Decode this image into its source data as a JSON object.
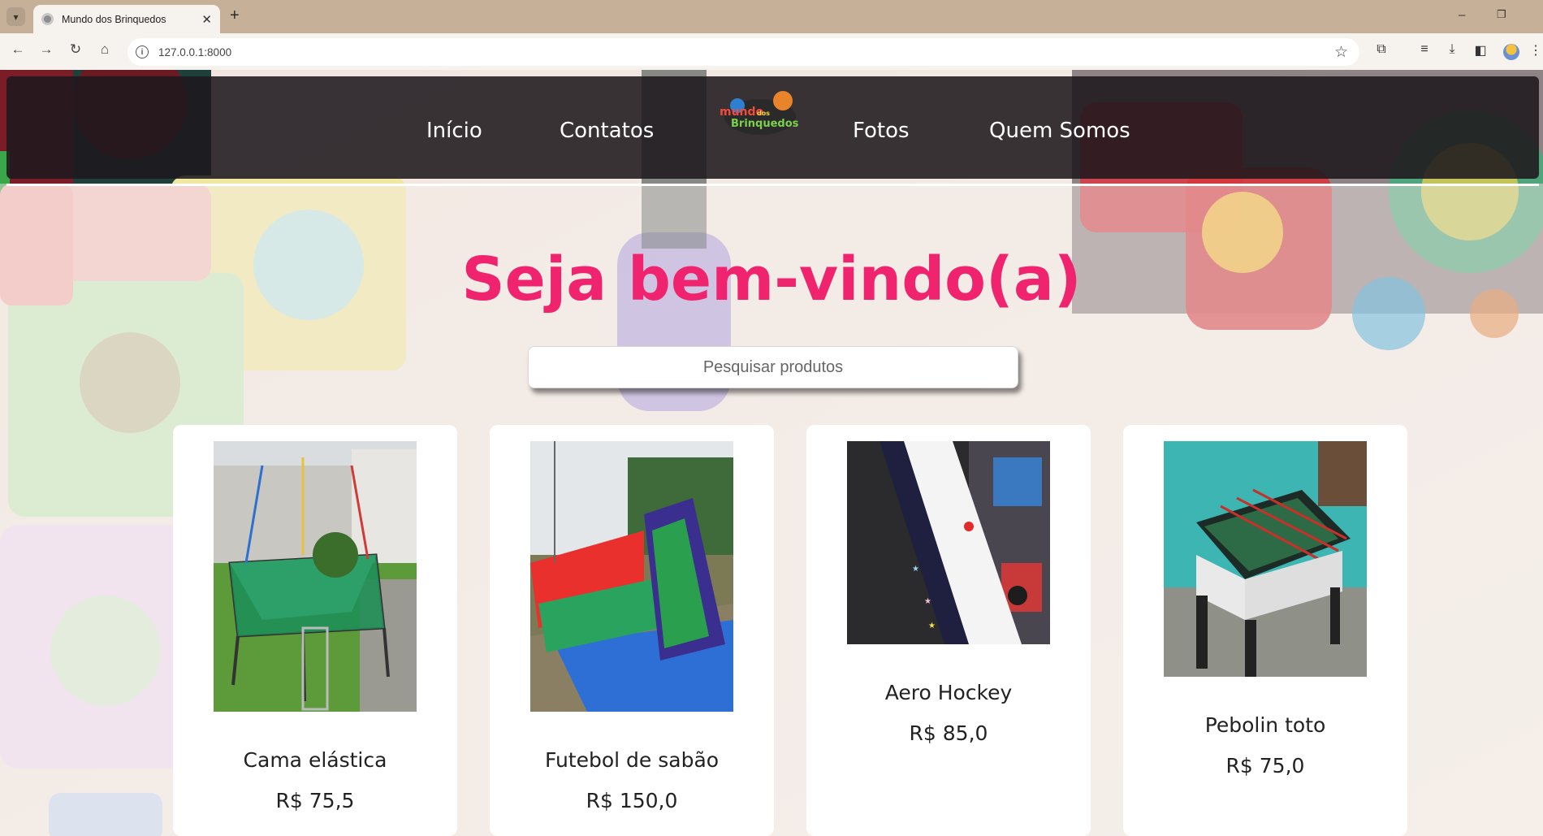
{
  "browser": {
    "tab_title": "Mundo dos Brinquedos",
    "url": "127.0.0.1:8000"
  },
  "nav": {
    "links": [
      "Início",
      "Contatos",
      "Fotos",
      "Quem Somos"
    ],
    "logo_text_top": "mundo",
    "logo_text_mid": "dos",
    "logo_text_bottom": "Brinquedos"
  },
  "hero": {
    "title": "Seja bem-vindo(a)"
  },
  "search": {
    "placeholder": "Pesquisar produtos"
  },
  "products": [
    {
      "name": "Cama elástica",
      "price": "R$ 75,5"
    },
    {
      "name": "Futebol de sabão",
      "price": "R$ 150,0"
    },
    {
      "name": "Aero Hockey",
      "price": "R$ 85,0"
    },
    {
      "name": "Pebolin toto",
      "price": "R$ 75,0"
    }
  ],
  "colors": {
    "accent": "#f0246e",
    "header_bg": "#1e181c",
    "chrome": "#c6b198"
  }
}
